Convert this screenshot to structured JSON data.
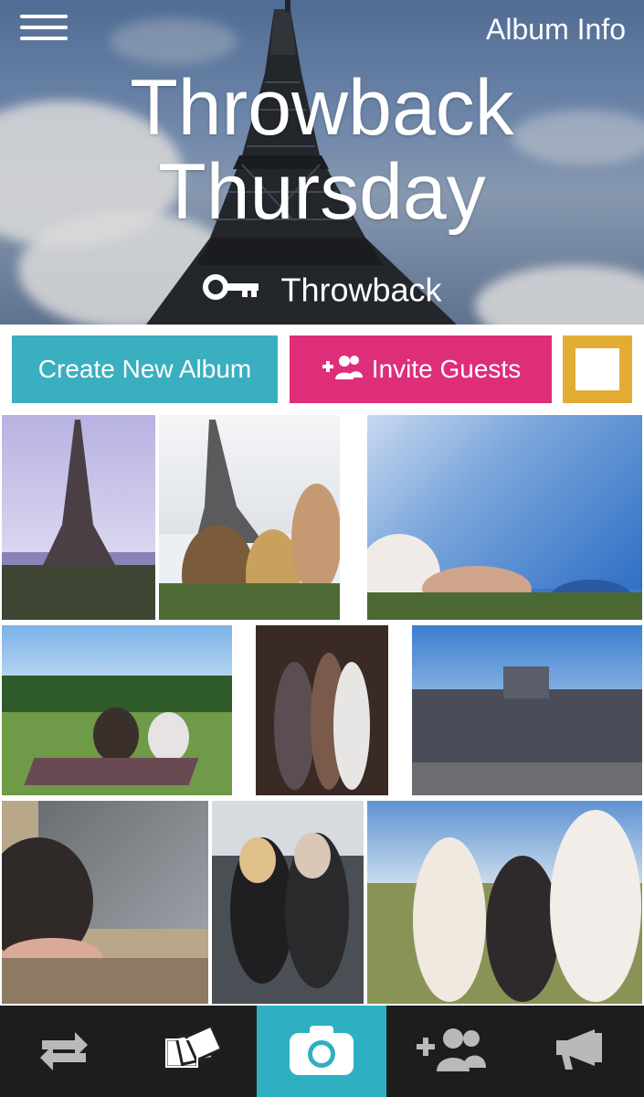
{
  "header": {
    "album_info_label": "Album Info",
    "album_title_line1": "Throwback",
    "album_title_line2": "Thursday",
    "album_key": "Throwback"
  },
  "actions": {
    "create_album_label": "Create New Album",
    "invite_guests_label": "Invite Guests"
  },
  "colors": {
    "create_button": "#3aafc0",
    "invite_button": "#de2e79",
    "select_outline": "#e2ac35",
    "camera_tab": "#2fb0c2",
    "bottom_bar": "#1d1d1d"
  },
  "photos_count": 9,
  "bottom_nav": [
    {
      "icon": "switch-icon"
    },
    {
      "icon": "photos-icon"
    },
    {
      "icon": "camera-icon"
    },
    {
      "icon": "add-guests-icon"
    },
    {
      "icon": "megaphone-icon"
    }
  ]
}
